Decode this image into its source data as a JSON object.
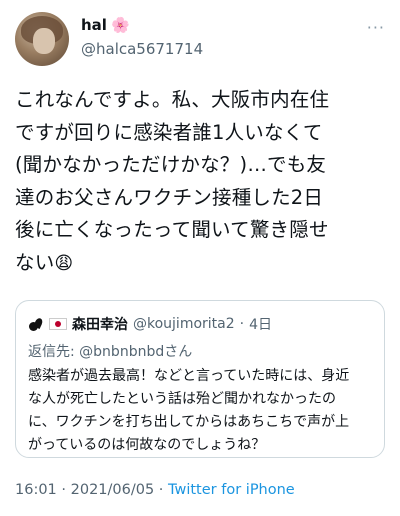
{
  "author": {
    "display_name": "hal",
    "name_emoji": "🌸",
    "handle": "@halca5671714",
    "more_menu_icon": "more-horizontal-icon"
  },
  "tweet": {
    "text": "これなんですよ。私、大阪市内在住\nですが回りに感染者誰1人いなくて\n(聞かなかっただけかな？)…でも友\n達のお父さんワクチン接種した2日\n後に亡くなったって聞いて驚き隠せ\nない",
    "trailing_emoji": "😩"
  },
  "quoted": {
    "avatar_icon": "black-cat-icon",
    "flag_icon": "japan-flag-icon",
    "name": "森田幸治",
    "handle": "@koujimorita2",
    "separator": "·",
    "time": "4日",
    "reply_prefix": "返信先: ",
    "reply_to": "@bnbnbnbdさん",
    "text": "感染者が過去最高！などと言っていた時には、身近\nな人が死亡したという話は殆ど聞かれなかったの\nに、ワクチンを打ち出してからはあちこちで声が上\nがっているのは何故なのでしょうね？"
  },
  "meta": {
    "time": "16:01",
    "separator1": " · ",
    "date": "2021/06/05",
    "separator2": " · ",
    "source": "Twitter for iPhone"
  },
  "colors": {
    "link": "#1b95e0",
    "secondary_text": "#536471",
    "border": "#cfd9de"
  }
}
